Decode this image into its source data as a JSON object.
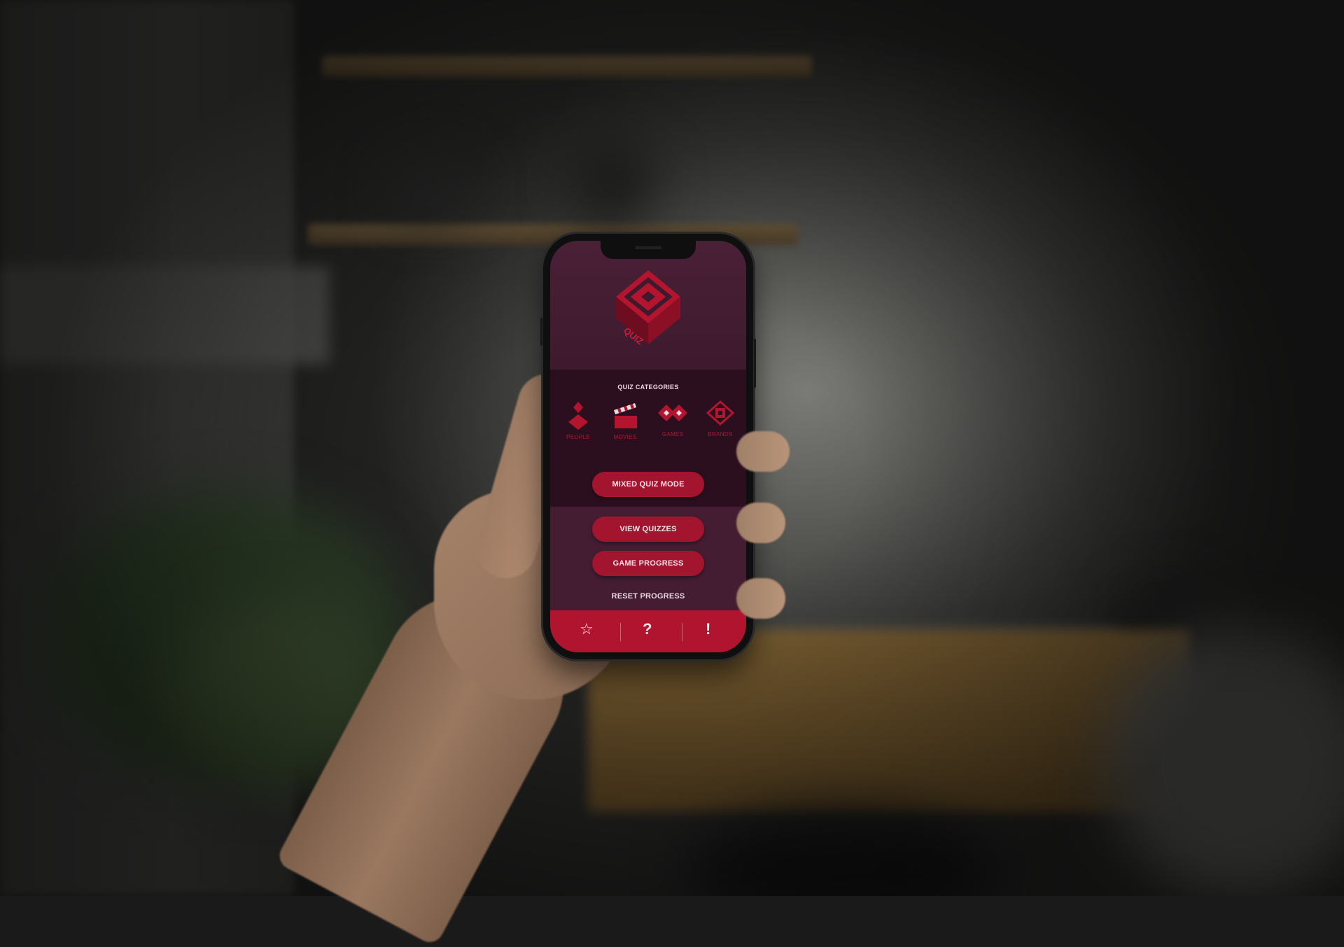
{
  "app": {
    "logo_text": "QUIZ",
    "accent_color": "#a3152e",
    "background_color": "#3d1a2c"
  },
  "categories": {
    "title": "QUIZ CATEGORIES",
    "items": [
      {
        "label": "PEOPLE",
        "icon": "people-diamond-icon"
      },
      {
        "label": "MOVIES",
        "icon": "clapperboard-icon"
      },
      {
        "label": "GAMES",
        "icon": "gamepad-diamond-icon"
      },
      {
        "label": "BRANDS",
        "icon": "brands-diamond-icon"
      }
    ]
  },
  "buttons": {
    "mixed_quiz": "MIXED QUIZ MODE",
    "view_quizzes": "VIEW QUIZZES",
    "game_progress": "GAME PROGRESS",
    "reset_progress": "RESET PROGRESS"
  },
  "tabbar": {
    "items": [
      {
        "icon": "star-icon",
        "glyph": "☆"
      },
      {
        "icon": "question-icon",
        "glyph": "?"
      },
      {
        "icon": "exclamation-icon",
        "glyph": "!"
      }
    ]
  }
}
